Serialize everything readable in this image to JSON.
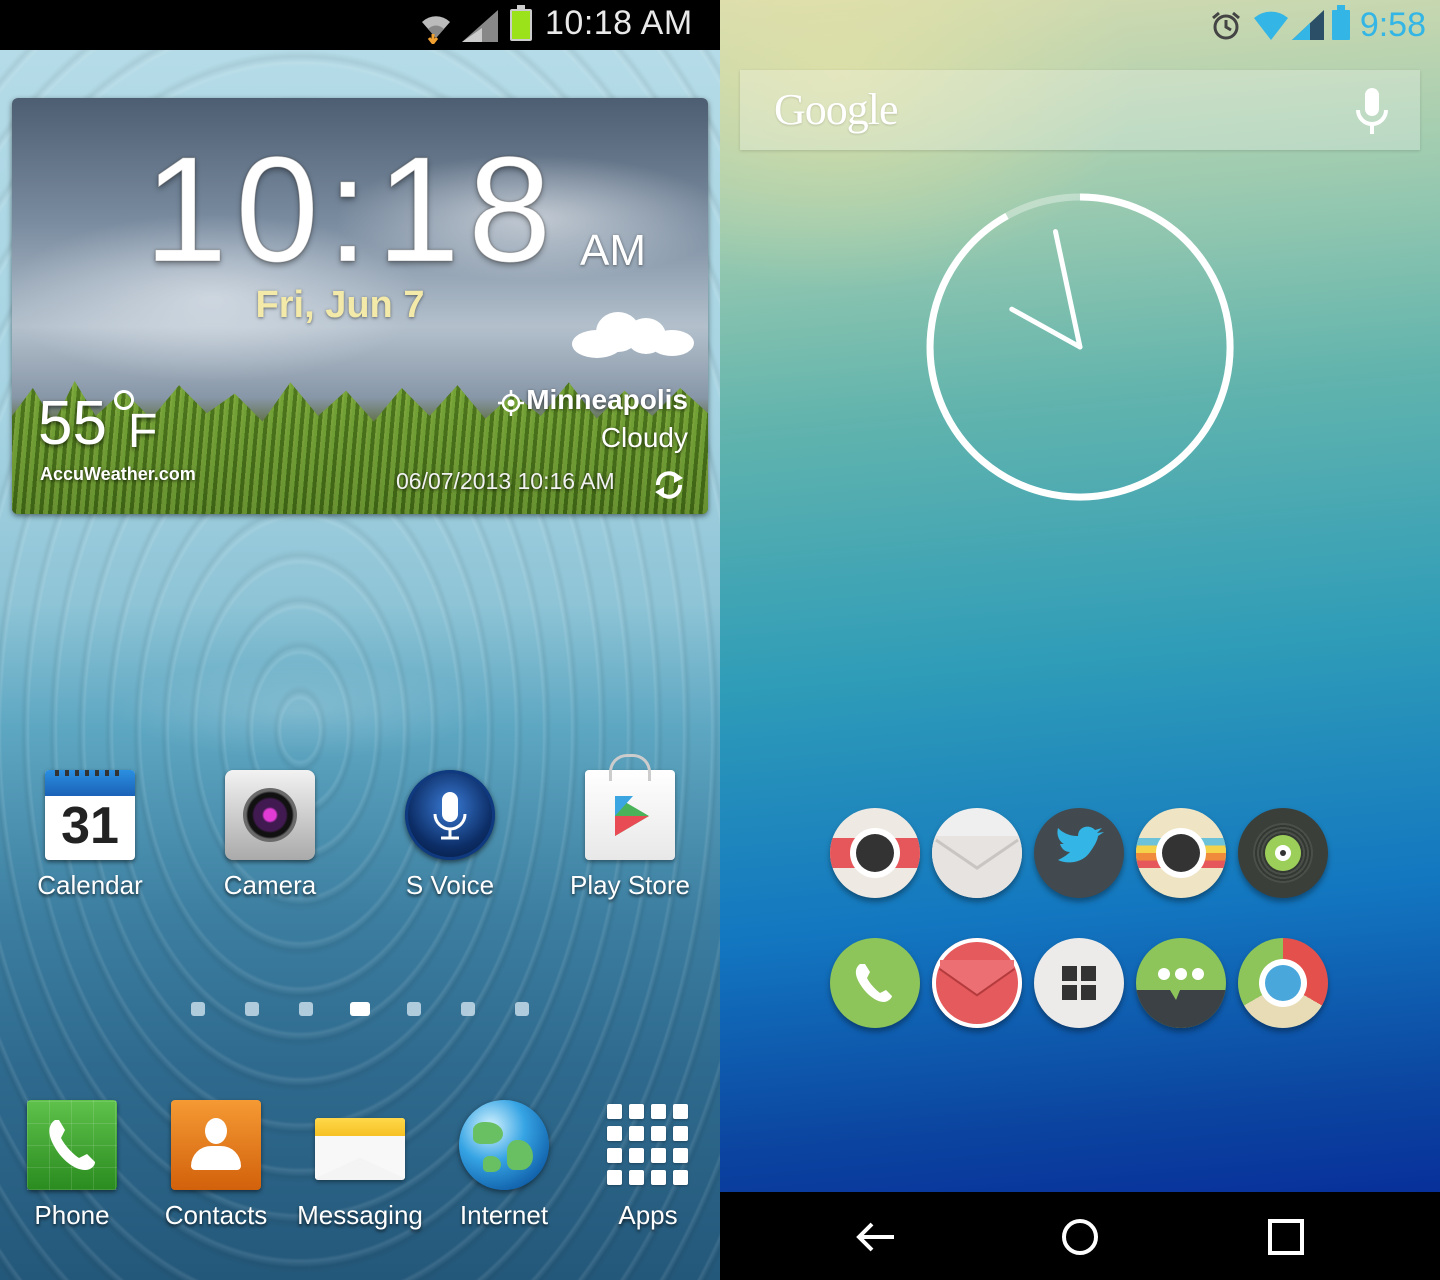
{
  "left_phone": {
    "status_bar": {
      "time": "10:18 AM"
    },
    "weather_widget": {
      "time": "10:18",
      "ampm": "AM",
      "date": "Fri, Jun 7",
      "temperature": "55",
      "unit": "F",
      "provider": "AccuWeather.com",
      "city": "Minneapolis",
      "condition": "Cloudy",
      "updated": "06/07/2013 10:16 AM"
    },
    "home_apps": [
      {
        "label": "Calendar",
        "icon": "calendar-icon",
        "day": "31"
      },
      {
        "label": "Camera",
        "icon": "camera-icon"
      },
      {
        "label": "S Voice",
        "icon": "microphone-icon"
      },
      {
        "label": "Play Store",
        "icon": "play-store-icon"
      }
    ],
    "page_indicator": {
      "count": 7,
      "active_index": 3
    },
    "dock": [
      {
        "label": "Phone",
        "icon": "phone-icon"
      },
      {
        "label": "Contacts",
        "icon": "contacts-icon"
      },
      {
        "label": "Messaging",
        "icon": "messaging-icon"
      },
      {
        "label": "Internet",
        "icon": "globe-icon"
      },
      {
        "label": "Apps",
        "icon": "apps-grid-icon"
      }
    ]
  },
  "right_phone": {
    "status_bar": {
      "time": "9:58",
      "accent": "#33b5e5"
    },
    "search_bar": {
      "logo": "Google",
      "mic": "mic-icon"
    },
    "analog_clock": {
      "hour": 9,
      "minute": 58
    },
    "icon_grid": [
      [
        "camera-icon",
        "mail-icon",
        "twitter-icon",
        "camera-icon",
        "music-icon"
      ],
      [
        "phone-icon",
        "gmail-icon",
        "apps-grid-icon",
        "messaging-icon",
        "chrome-icon"
      ]
    ],
    "nav_bar": [
      "back-icon",
      "home-icon",
      "recents-icon"
    ]
  }
}
